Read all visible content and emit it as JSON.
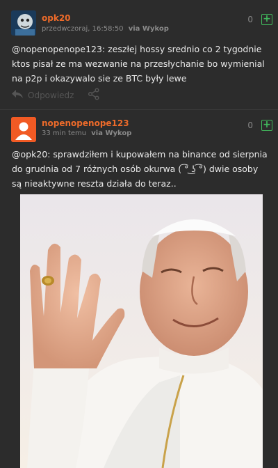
{
  "entries": [
    {
      "author": "opk20",
      "time": "przedwczoraj, 16:58:50",
      "via": "via Wykop",
      "votes": "0",
      "plus": "+",
      "mention": "@nopenopenope123",
      "body": ": zeszłej hossy srednio co 2 tygodnie ktos pisał ze ma wezwanie na przesłychanie bo wymienial na p2p i okazywalo sie ze BTC były lewe",
      "reply_label": "Odpowiedz"
    },
    {
      "author": "nopenopenope123",
      "time": "33 min temu",
      "via": "via Wykop",
      "votes": "0",
      "plus": "+",
      "mention": "@opk20",
      "body": ": sprawdziłem i kupowałem na binance od sierpnia do grudnia od 7 różnych osób okurwa ( ͡° ͜ʖ ͡°) dwie osoby są nieaktywne reszta działa do teraz..",
      "image": "photo-elderly-man-waving"
    }
  ],
  "colors": {
    "background": "#2c2c2c",
    "author": "#ee6b2a",
    "mention": "#e9e9e9",
    "plus": "#41b95d",
    "meta": "#8a8a8a"
  },
  "icons": [
    "reply-icon",
    "share-icon",
    "plus-icon",
    "user-avatar-icon"
  ]
}
